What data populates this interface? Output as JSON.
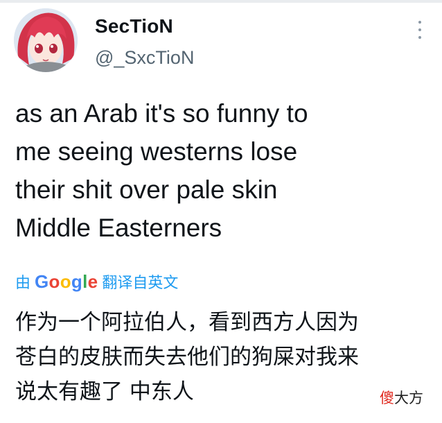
{
  "tweet": {
    "display_name": "SecTioN",
    "handle": "@_SxcTioN",
    "more_icon": "more-vertical-icon",
    "body_lines": [
      "as an Arab it's so funny to",
      "me seeing westerns lose",
      "their shit over pale skin",
      "Middle Easterners"
    ]
  },
  "translation": {
    "prefix": "由",
    "google": [
      "G",
      "o",
      "o",
      "g",
      "l",
      "e"
    ],
    "suffix": "翻译自英文",
    "lines": [
      "作为一个阿拉伯人，看到西方人因为",
      "苍白的皮肤而失去他们的狗屎对我来",
      "说太有趣了 中东人"
    ]
  },
  "watermark": {
    "part1": "傻",
    "part2": "大方"
  },
  "colors": {
    "link": "#1d9bf0",
    "secondary_text": "#536471",
    "google_blue": "#4285f4",
    "google_red": "#ea4335",
    "google_yellow": "#fbbc05",
    "google_green": "#34a853"
  }
}
